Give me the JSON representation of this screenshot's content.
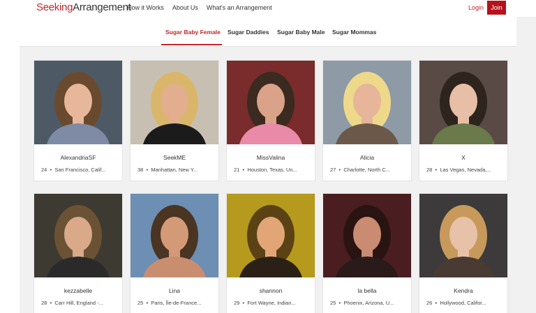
{
  "header": {
    "logo_part1": "Seeking",
    "logo_part2": "Arrangement",
    "nav": [
      "How it Works",
      "About Us",
      "What's an Arrangement"
    ],
    "login": "Login",
    "join": "Join"
  },
  "tabs": [
    "Sugar Baby Female",
    "Sugar Daddies",
    "Sugar Baby Male",
    "Sugar Mommas"
  ],
  "active_tab": "Sugar Baby Female",
  "accent_color": "#c0272d",
  "profiles": [
    {
      "name": "AlexandriaSF",
      "age": "24",
      "location": "San Francisco, Calif..."
    },
    {
      "name": "SeekME",
      "age": "38",
      "location": "Manhattan, New Y..."
    },
    {
      "name": "MissValina",
      "age": "21",
      "location": "Houston, Texas, Un..."
    },
    {
      "name": "Alicia",
      "age": "27",
      "location": "Charlotte, North C..."
    },
    {
      "name": "X",
      "age": "28",
      "location": "Las Vegas, Nevada,..."
    },
    {
      "name": "kezzabelle",
      "age": "28",
      "location": "Carr Hill, England -..."
    },
    {
      "name": "Lina",
      "age": "25",
      "location": "Paris, Île-de-France..."
    },
    {
      "name": "shannon",
      "age": "29",
      "location": "Fort Wayne, Indian..."
    },
    {
      "name": "la bella",
      "age": "25",
      "location": "Phoenix, Arizona, U..."
    },
    {
      "name": "Kendra",
      "age": "26",
      "location": "Hollywood, Califor..."
    }
  ]
}
